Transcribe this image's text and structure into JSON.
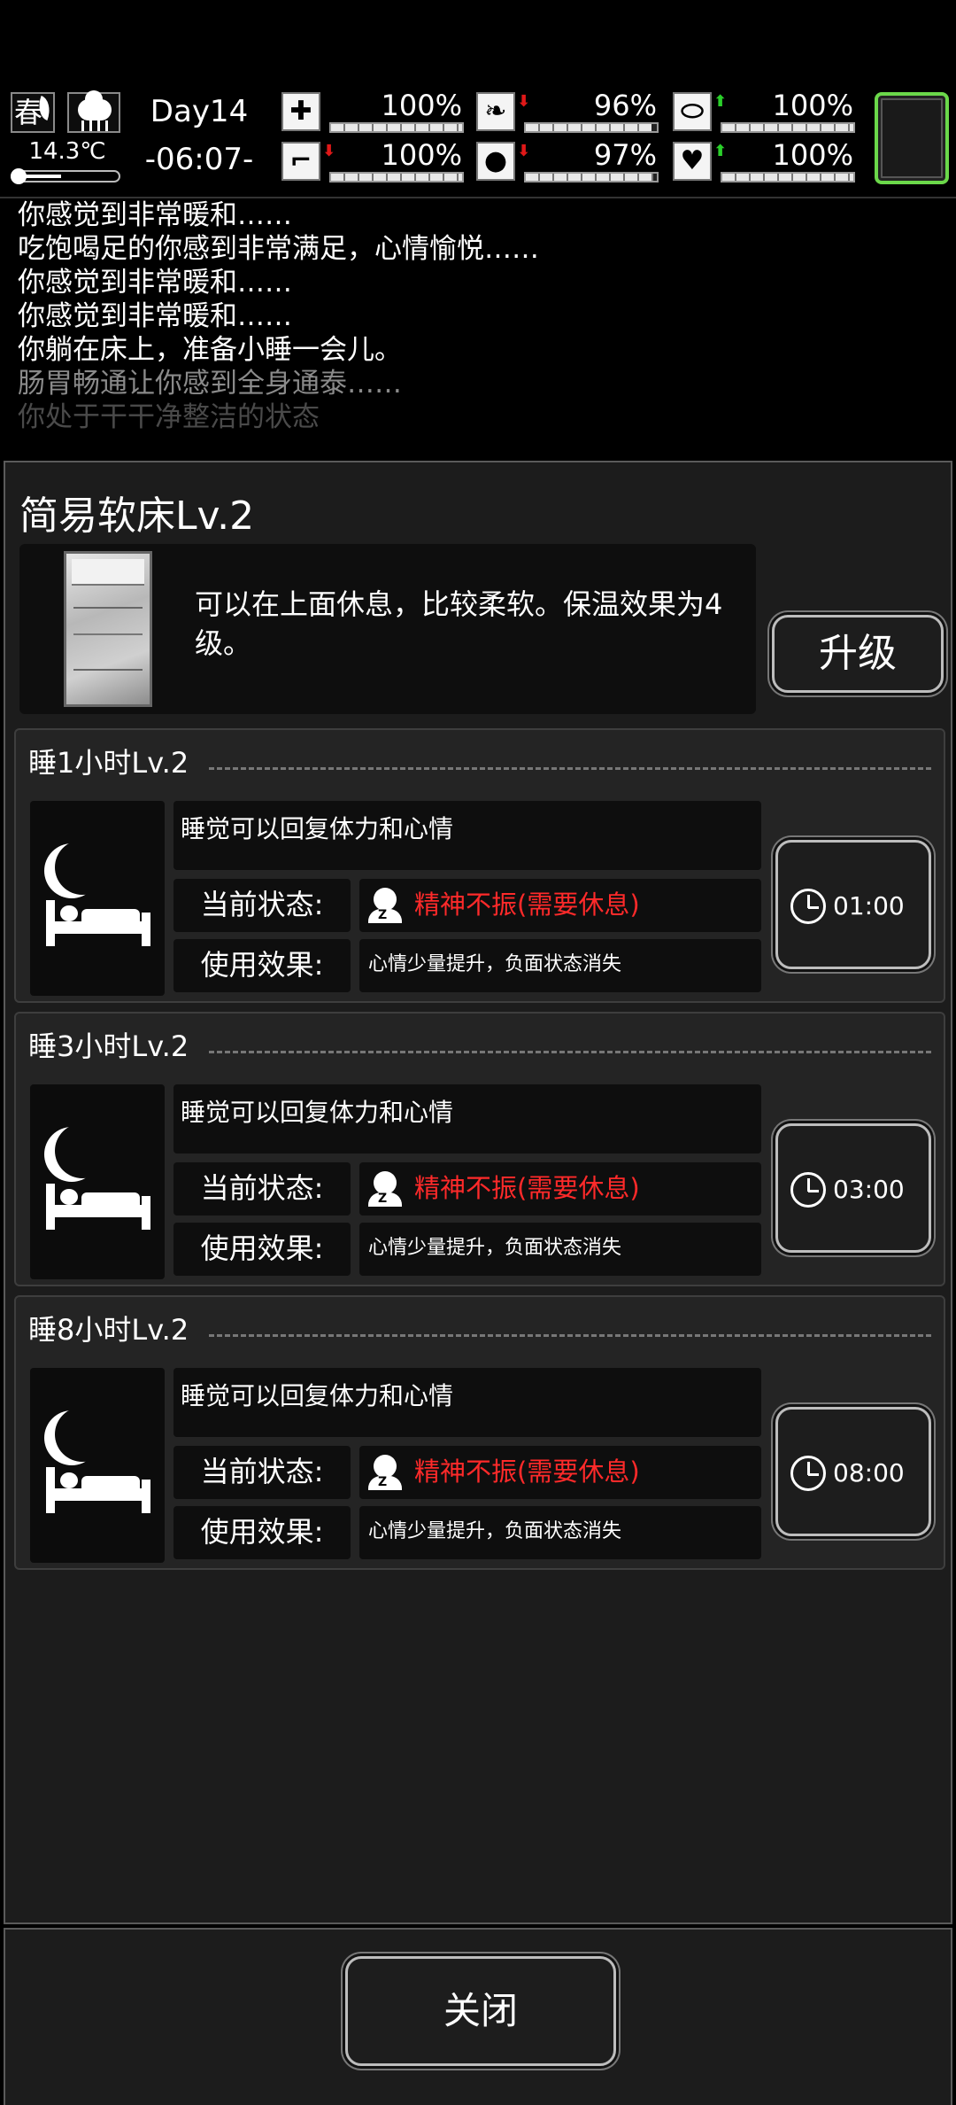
{
  "hud": {
    "season": "春",
    "temperature": "14.3℃",
    "thermometer_level": 0.45,
    "day": "Day14",
    "time": "-06:07-",
    "stats": [
      {
        "name": "health",
        "icon": "medkit-icon",
        "value": "100%",
        "level": 1.0,
        "trend": ""
      },
      {
        "name": "hunger",
        "icon": "stomach-icon",
        "value": "96%",
        "level": 0.96,
        "trend": "down"
      },
      {
        "name": "stamina",
        "icon": "pill-icon",
        "value": "100%",
        "level": 1.0,
        "trend": "up"
      },
      {
        "name": "foot",
        "icon": "foot-icon",
        "value": "100%",
        "level": 1.0,
        "trend": "down"
      },
      {
        "name": "thirst",
        "icon": "water-drop-icon",
        "value": "97%",
        "level": 0.97,
        "trend": "down"
      },
      {
        "name": "mood",
        "icon": "heart-icon",
        "value": "100%",
        "level": 1.0,
        "trend": "up"
      }
    ]
  },
  "log": [
    "你感觉到非常暖和……",
    "吃饱喝足的你感到非常满足，心情愉悦……",
    "你感觉到非常暖和……",
    "你感觉到非常暖和……",
    "你躺在床上，准备小睡一会儿。",
    "肠胃畅通让你感到全身通泰……",
    "你处于干干净整洁的状态"
  ],
  "item": {
    "title": "简易软床Lv.2",
    "description": "可以在上面休息，比较柔软。保温效果为4级。",
    "upgrade_label": "升级"
  },
  "actions": [
    {
      "title": "睡1小时Lv.2",
      "description": "睡觉可以回复体力和心情",
      "state_label": "当前状态:",
      "state_value": "精神不振(需要休息)",
      "effect_label": "使用效果:",
      "effect_value": "心情少量提升，负面状态消失",
      "time": "01:00"
    },
    {
      "title": "睡3小时Lv.2",
      "description": "睡觉可以回复体力和心情",
      "state_label": "当前状态:",
      "state_value": "精神不振(需要休息)",
      "effect_label": "使用效果:",
      "effect_value": "心情少量提升，负面状态消失",
      "time": "03:00"
    },
    {
      "title": "睡8小时Lv.2",
      "description": "睡觉可以回复体力和心情",
      "state_label": "当前状态:",
      "state_value": "精神不振(需要休息)",
      "effect_label": "使用效果:",
      "effect_value": "心情少量提升，负面状态消失",
      "time": "08:00"
    }
  ],
  "footer": {
    "close_label": "关闭"
  },
  "colors": {
    "warning": "#ff2a2a",
    "trend_up": "#2ad02a",
    "trend_down": "#e01818",
    "slot_border": "#6bd84a"
  }
}
